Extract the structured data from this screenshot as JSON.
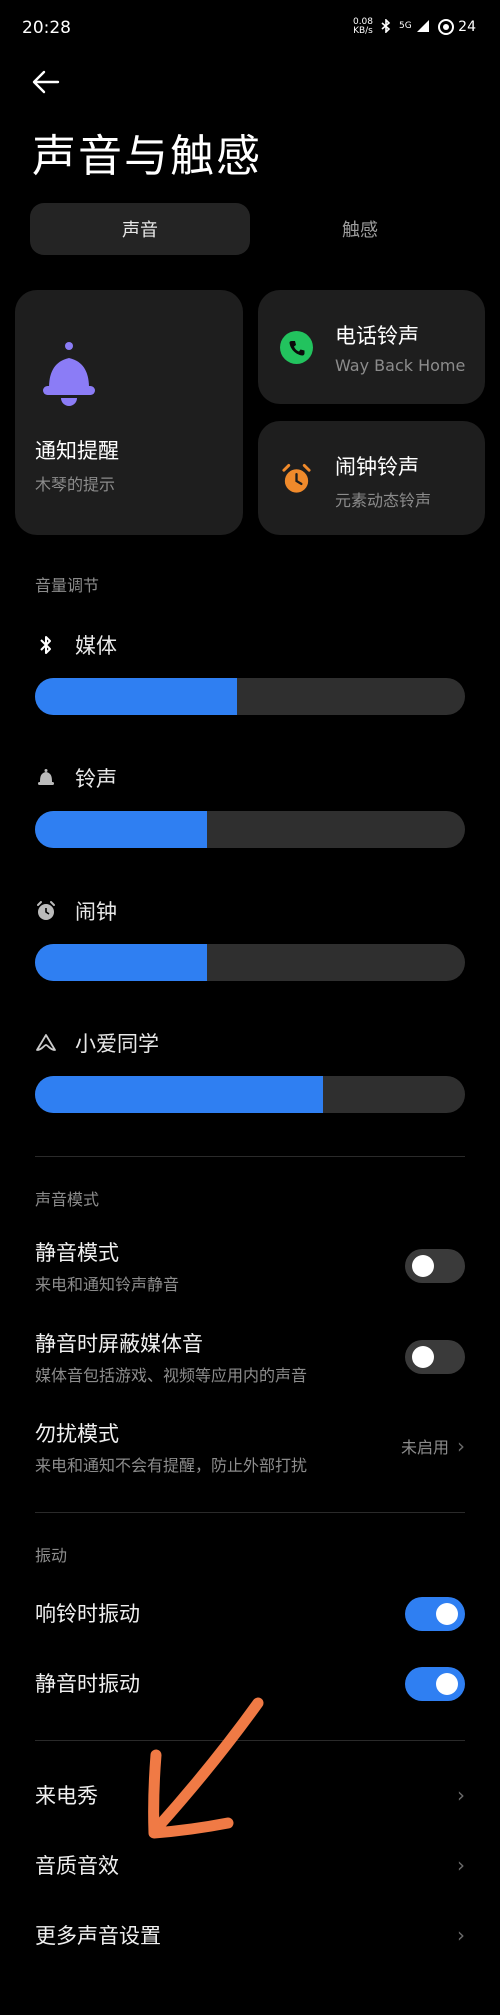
{
  "status_bar": {
    "time": "20:28",
    "net_speed_value": "0.08",
    "net_speed_unit": "KB/s",
    "signal": "5G",
    "battery": "24"
  },
  "page": {
    "title": "声音与触感"
  },
  "tabs": [
    {
      "label": "声音",
      "active": true
    },
    {
      "label": "触感",
      "active": false
    }
  ],
  "cards": {
    "notification": {
      "title": "通知提醒",
      "subtitle": "木琴的提示",
      "icon": "bell-icon",
      "color": "#8b7cf6"
    },
    "ringtone": {
      "title": "电话铃声",
      "subtitle": "Way Back Home",
      "icon": "phone-icon",
      "color": "#22c35e"
    },
    "alarm": {
      "title": "闹钟铃声",
      "subtitle": "元素动态铃声",
      "icon": "alarm-clock-icon",
      "color": "#f08a2b"
    }
  },
  "volume": {
    "section_label": "音量调节",
    "sliders": [
      {
        "label": "媒体",
        "icon": "bluetooth-icon",
        "level": 0.47
      },
      {
        "label": "铃声",
        "icon": "bell-icon",
        "level": 0.4
      },
      {
        "label": "闹钟",
        "icon": "alarm-clock-icon",
        "level": 0.4
      },
      {
        "label": "小爱同学",
        "icon": "xiaoai-icon",
        "level": 0.67
      }
    ]
  },
  "sound_mode": {
    "section_label": "声音模式",
    "silent": {
      "title": "静音模式",
      "subtitle": "来电和通知铃声静音",
      "on": false
    },
    "mute_media": {
      "title": "静音时屏蔽媒体音",
      "subtitle": "媒体音包括游戏、视频等应用内的声音",
      "on": false
    },
    "dnd": {
      "title": "勿扰模式",
      "subtitle": "来电和通知不会有提醒，防止外部打扰",
      "value": "未启用"
    }
  },
  "vibration": {
    "section_label": "振动",
    "ring_vibrate": {
      "title": "响铃时振动",
      "on": true
    },
    "silent_vibrate": {
      "title": "静音时振动",
      "on": true
    }
  },
  "links": [
    {
      "label": "来电秀"
    },
    {
      "label": "音质音效"
    },
    {
      "label": "更多声音设置"
    }
  ],
  "colors": {
    "accent": "#2f7ff2",
    "annotation_arrow": "#f07a45"
  }
}
